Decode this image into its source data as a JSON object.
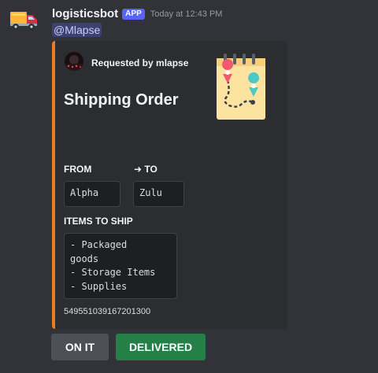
{
  "message": {
    "username": "logisticsbot",
    "badge": "APP",
    "timestamp": "Today at 12:43 PM",
    "mention": "@Mlapse",
    "avatar_icon": "delivery-truck-icon"
  },
  "embed": {
    "accent_color": "#e67e22",
    "author": "Requested by mlapse",
    "title": "Shipping Order",
    "thumbnail_icon": "route-map-notebook-icon",
    "fields": {
      "from": {
        "name": "FROM",
        "value": "Alpha"
      },
      "to": {
        "name": "➜ TO",
        "value": "Zulu"
      },
      "items": {
        "name": "ITEMS TO SHIP",
        "value": "- Packaged\ngoods\n- Storage Items\n- Supplies"
      }
    },
    "footer": "549551039167201300"
  },
  "buttons": {
    "on_it": "ON IT",
    "delivered": "DELIVERED"
  },
  "colors": {
    "background": "#313338",
    "embed_background": "#2b2d31",
    "secondary_button": "#4e5058",
    "success_button": "#248046",
    "app_badge": "#5865f2"
  }
}
